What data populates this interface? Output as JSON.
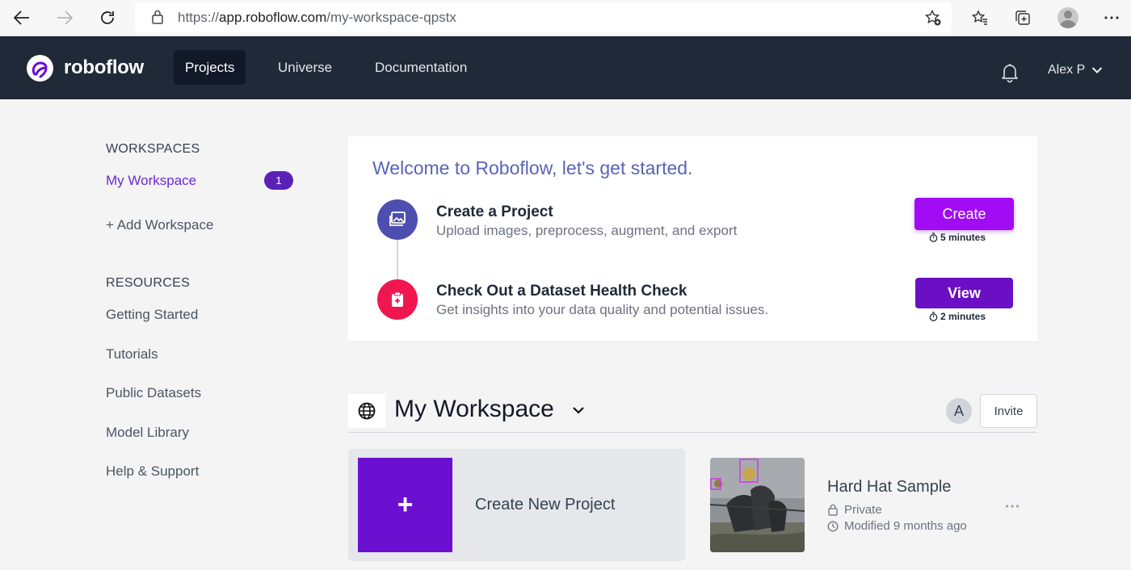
{
  "browser": {
    "url_scheme": "https://",
    "url_host": "app.roboflow.com",
    "url_path": "/my-workspace-qpstx"
  },
  "navbar": {
    "logo_text": "roboflow",
    "items": [
      {
        "label": "Projects",
        "active": true
      },
      {
        "label": "Universe",
        "active": false
      },
      {
        "label": "Documentation",
        "active": false
      }
    ],
    "user_name": "Alex P"
  },
  "sidebar": {
    "workspaces_heading": "WORKSPACES",
    "workspace_name": "My Workspace",
    "workspace_badge": "1",
    "add_workspace": "+ Add Workspace",
    "resources_heading": "RESOURCES",
    "resources": [
      "Getting Started",
      "Tutorials",
      "Public Datasets",
      "Model Library",
      "Help & Support"
    ]
  },
  "welcome": {
    "title": "Welcome to Roboflow, let's get started.",
    "steps": [
      {
        "title": "Create a Project",
        "description": "Upload images, preprocess, augment, and export",
        "button": "Create",
        "duration": "5 minutes",
        "icon": "images-icon",
        "color": "#4d4fb0"
      },
      {
        "title": "Check Out a Dataset Health Check",
        "description": "Get insights into your data quality and potential issues.",
        "button": "View",
        "duration": "2 minutes",
        "icon": "clipboard-health-icon",
        "color": "#f01750"
      }
    ]
  },
  "workspace": {
    "title": "My Workspace",
    "member_initial": "A",
    "invite_label": "Invite"
  },
  "projects": {
    "create_label": "Create New Project",
    "items": [
      {
        "name": "Hard Hat Sample",
        "visibility": "Private",
        "modified": "Modified 9 months ago"
      }
    ]
  },
  "colors": {
    "nav_bg": "#1f2937",
    "accent_purple": "#6b0fd1",
    "create_button": "#a10cf5",
    "heading_blue": "#5b63b7"
  }
}
